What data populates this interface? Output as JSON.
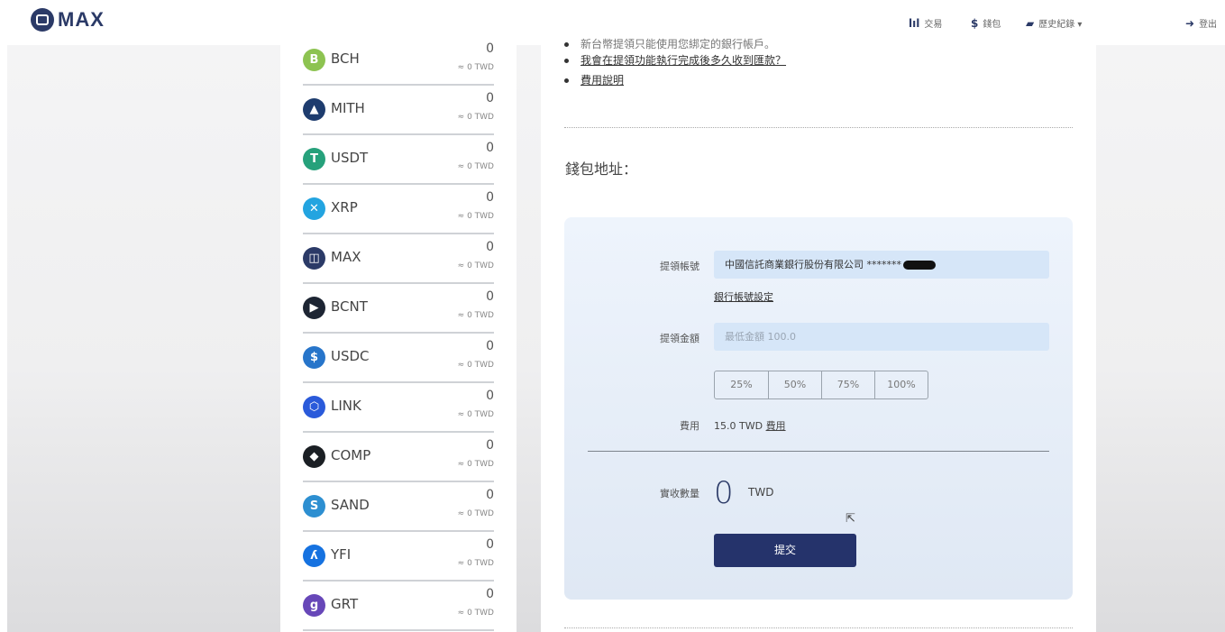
{
  "header": {
    "logo_text": "MAX",
    "nav": [
      {
        "icon": "bar-chart-icon",
        "glyph": "lıl",
        "label": "交易"
      },
      {
        "icon": "dollar-icon",
        "glyph": "$",
        "label": "錢包"
      },
      {
        "icon": "book-icon",
        "glyph": "▰",
        "label": "歷史紀錄 ▾"
      },
      {
        "icon": "logout-icon",
        "glyph": "➜",
        "label": "登出"
      }
    ]
  },
  "coins": [
    {
      "symbol": "BCH",
      "amount": "0",
      "twd": "≈ 0 TWD",
      "icon": "bch-icon",
      "glyph": "B",
      "color": "#8dc351"
    },
    {
      "symbol": "MITH",
      "amount": "0",
      "twd": "≈ 0 TWD",
      "icon": "mith-icon",
      "glyph": "▲",
      "color": "#1e3c6e"
    },
    {
      "symbol": "USDT",
      "amount": "0",
      "twd": "≈ 0 TWD",
      "icon": "usdt-icon",
      "glyph": "T",
      "color": "#26a17b"
    },
    {
      "symbol": "XRP",
      "amount": "0",
      "twd": "≈ 0 TWD",
      "icon": "xrp-icon",
      "glyph": "✕",
      "color": "#23a4e0"
    },
    {
      "symbol": "MAX",
      "amount": "0",
      "twd": "≈ 0 TWD",
      "icon": "max-icon",
      "glyph": "◫",
      "color": "#2b3a67"
    },
    {
      "symbol": "BCNT",
      "amount": "0",
      "twd": "≈ 0 TWD",
      "icon": "bcnt-icon",
      "glyph": "▶",
      "color": "#1d2533"
    },
    {
      "symbol": "USDC",
      "amount": "0",
      "twd": "≈ 0 TWD",
      "icon": "usdc-icon",
      "glyph": "$",
      "color": "#2775ca"
    },
    {
      "symbol": "LINK",
      "amount": "0",
      "twd": "≈ 0 TWD",
      "icon": "link-icon",
      "glyph": "⬡",
      "color": "#2a5ada"
    },
    {
      "symbol": "COMP",
      "amount": "0",
      "twd": "≈ 0 TWD",
      "icon": "comp-icon",
      "glyph": "◆",
      "color": "#1b1f24"
    },
    {
      "symbol": "SAND",
      "amount": "0",
      "twd": "≈ 0 TWD",
      "icon": "sand-icon",
      "glyph": "S",
      "color": "#2d8fd1"
    },
    {
      "symbol": "YFI",
      "amount": "0",
      "twd": "≈ 0 TWD",
      "icon": "yfi-icon",
      "glyph": "ʎ",
      "color": "#1672e0"
    },
    {
      "symbol": "GRT",
      "amount": "0",
      "twd": "≈ 0 TWD",
      "icon": "grt-icon",
      "glyph": "g",
      "color": "#6747b8"
    }
  ],
  "faq": {
    "item1": "新台幣提領只能使用您綁定的銀行帳戶。",
    "item2": "我會在提領功能執行完成後多久收到匯款？",
    "item3": "費用說明"
  },
  "wallet_label": "錢包地址：",
  "form": {
    "account_label": "提領帳號",
    "account_value": "中國信託商業銀行股份有限公司 *******",
    "bank_settings_link": "銀行帳號設定",
    "amount_label": "提領金額",
    "amount_placeholder": "最低金額 100.0",
    "percent_options": [
      "25%",
      "50%",
      "75%",
      "100%"
    ],
    "fee_label": "費用",
    "fee_value": "15.0 TWD",
    "fee_link": "費用",
    "received_label": "實收數量",
    "received_amount": "0",
    "received_unit": "TWD",
    "submit_label": "提交"
  }
}
